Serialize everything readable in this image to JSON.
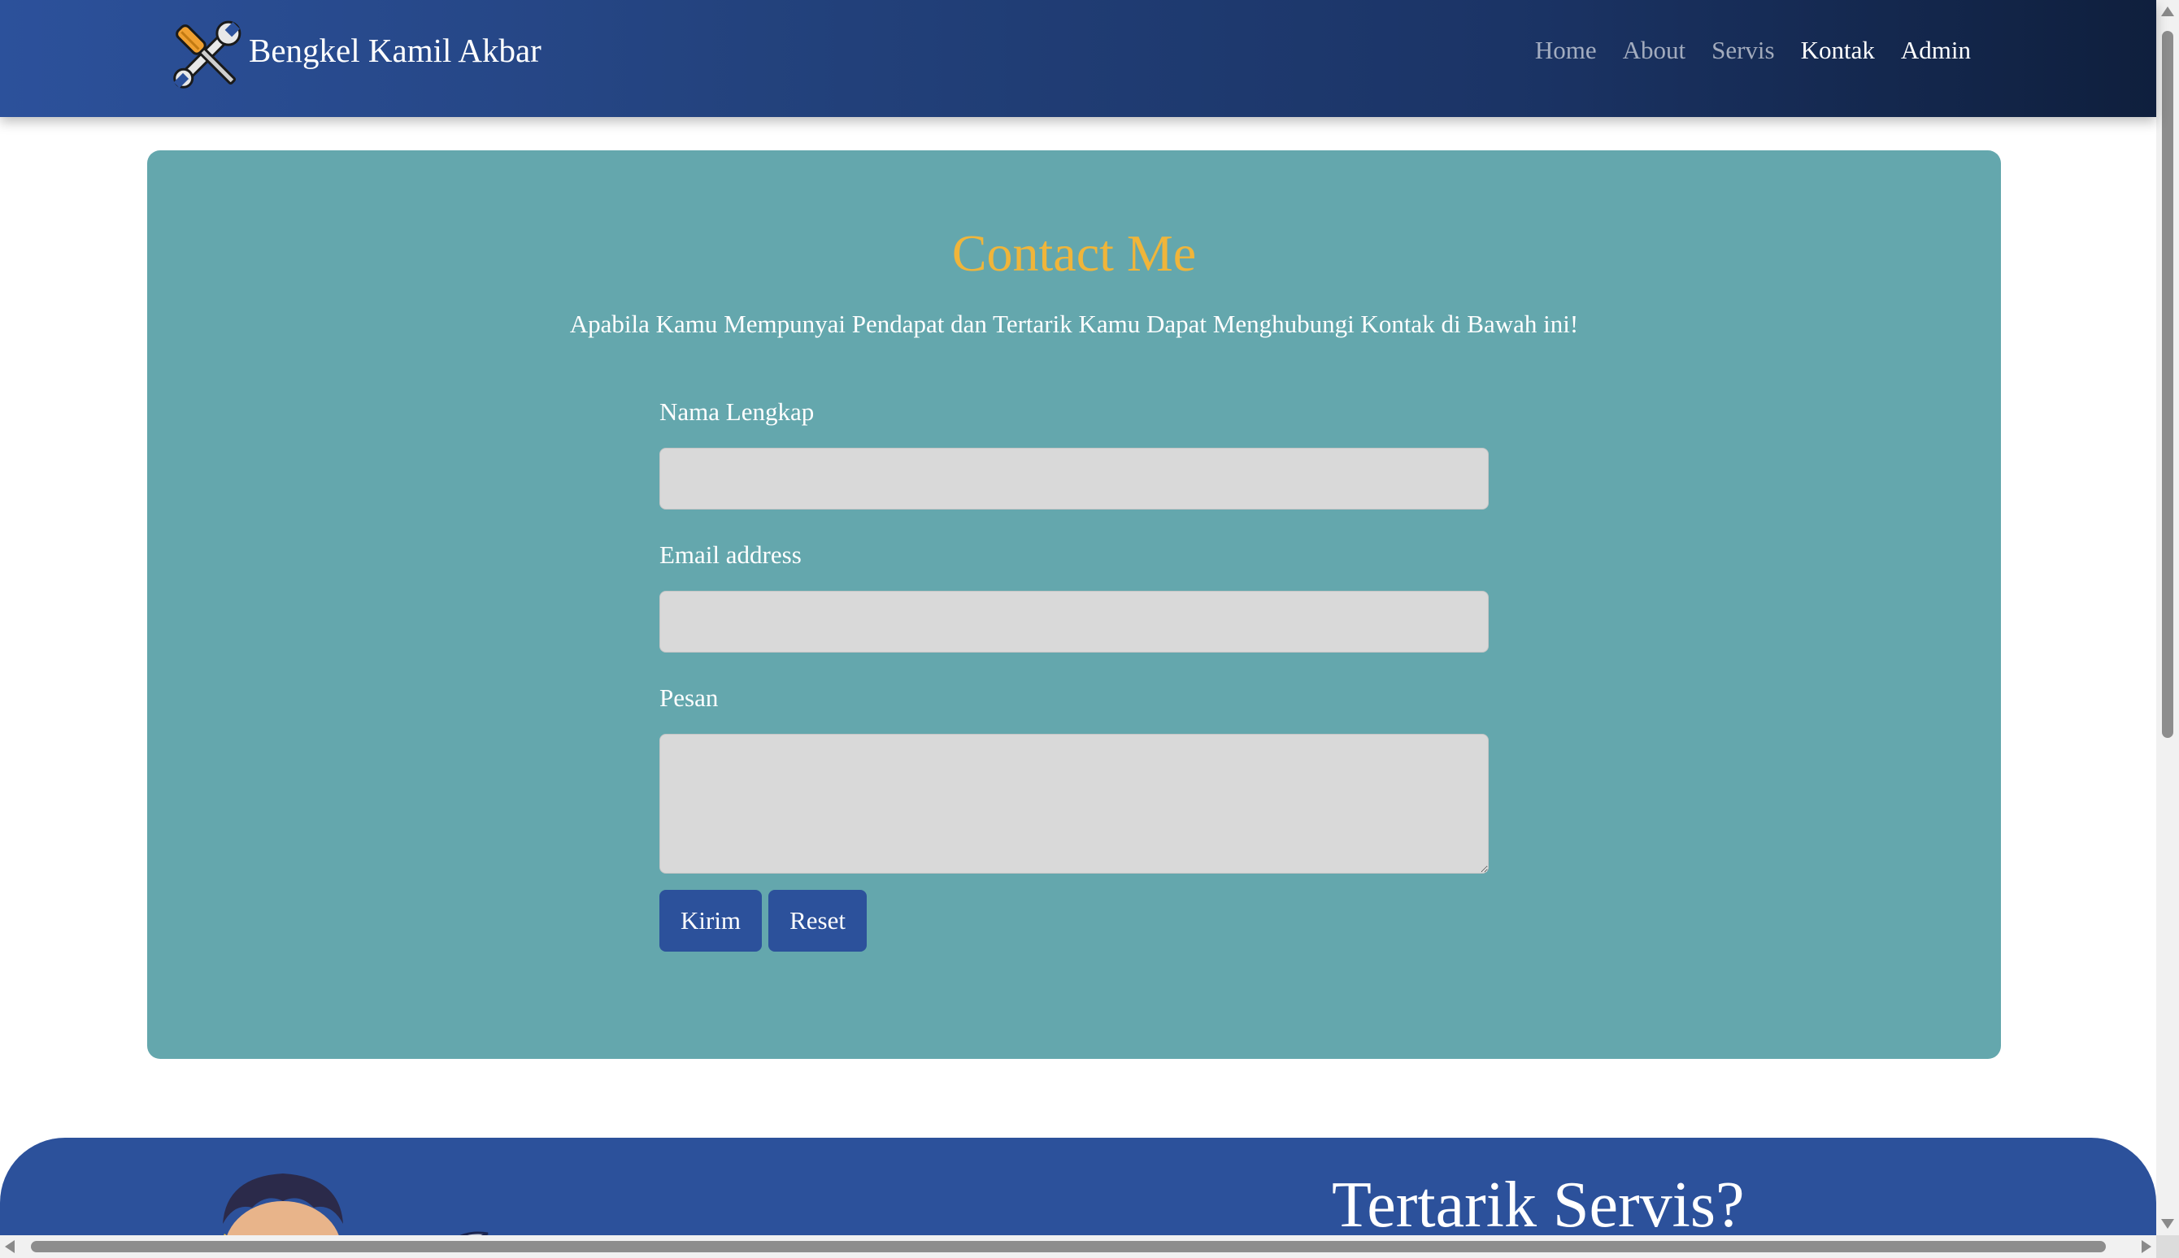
{
  "brand": {
    "name": "Bengkel Kamil Akbar",
    "logo_icon": "wrench-screwdriver-icon"
  },
  "nav": {
    "items": [
      {
        "label": "Home"
      },
      {
        "label": "About"
      },
      {
        "label": "Servis"
      },
      {
        "label": "Kontak",
        "active": true
      },
      {
        "label": "Admin"
      }
    ]
  },
  "contact": {
    "title": "Contact Me",
    "subtitle": "Apabila Kamu Mempunyai Pendapat dan Tertarik Kamu Dapat Menghubungi Kontak di Bawah ini!",
    "fields": {
      "name_label": "Nama Lengkap",
      "name_value": "",
      "email_label": "Email address",
      "email_value": "",
      "message_label": "Pesan",
      "message_value": ""
    },
    "buttons": {
      "submit": "Kirim",
      "reset": "Reset"
    }
  },
  "banner": {
    "title": "Tertarik Servis?"
  },
  "colors": {
    "nav_start": "#2c519b",
    "nav_end": "#0f1f3d",
    "card_bg": "#64a7ad",
    "title": "#f0b53a",
    "button_bg": "#2c519b",
    "input_bg": "#d9d9d9",
    "banner_bg": "#2c519b"
  }
}
